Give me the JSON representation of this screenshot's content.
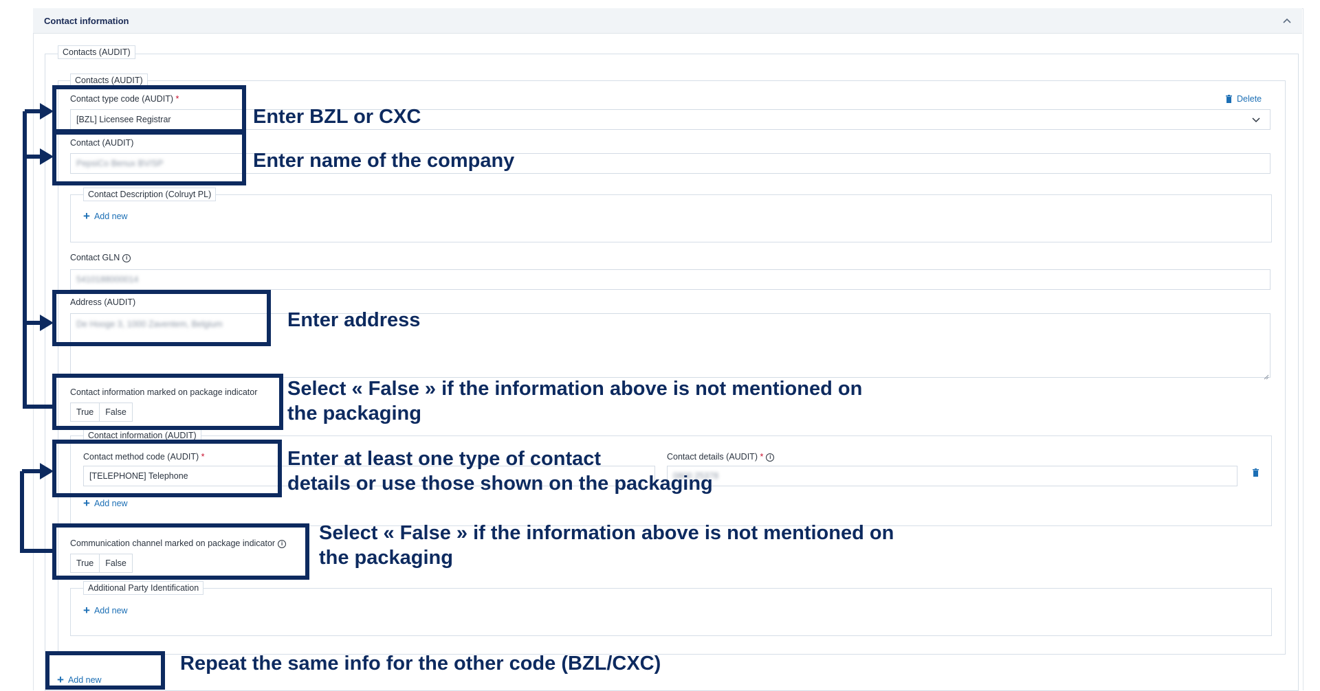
{
  "section": {
    "title": "Contact information"
  },
  "contacts_outer": {
    "legend": "Contacts (AUDIT)"
  },
  "contacts_inner": {
    "legend": "Contacts (AUDIT)",
    "delete_label": "Delete",
    "contact_type": {
      "label": "Contact type code (AUDIT)",
      "required_mark": "*",
      "value": "[BZL] Licensee Registrar"
    },
    "contact": {
      "label": "Contact (AUDIT)",
      "value": "PepsiCo Benux BV/SP"
    },
    "description": {
      "legend": "Contact Description (Colruyt PL)",
      "add_new": "Add new"
    },
    "gln": {
      "label": "Contact GLN",
      "value": "5410188000014"
    },
    "address": {
      "label": "Address (AUDIT)",
      "value": "De Hooge 3, 1000 Zaventem, Belgium"
    },
    "package_indicator": {
      "label": "Contact information marked on package indicator",
      "true_label": "True",
      "false_label": "False"
    },
    "contact_info": {
      "legend": "Contact information (AUDIT)",
      "method": {
        "label": "Contact method code (AUDIT)",
        "required_mark": "*",
        "value": "[TELEPHONE] Telephone"
      },
      "details": {
        "label": "Contact details (AUDIT)",
        "required_mark": "*",
        "value": "0800 25378"
      },
      "add_new": "Add new"
    },
    "channel_indicator": {
      "label": "Communication channel marked on package indicator",
      "true_label": "True",
      "false_label": "False"
    },
    "additional_party": {
      "legend": "Additional Party Identification",
      "add_new": "Add new"
    }
  },
  "bottom_add_new": "Add new",
  "annotations": {
    "a1": "Enter BZL or CXC",
    "a2": "Enter name of the company",
    "a3": "Enter address",
    "a4_line1": "Select « False » if  the information above is not mentioned on",
    "a4_line2": "the packaging",
    "a5_line1": "Enter at least one type of contact",
    "a5_line2": "details or use those shown on the packaging",
    "a6_line1": "Select « False » if the information above is not mentioned on",
    "a6_line2": "the packaging",
    "a7": "Repeat the same info for the other code (BZL/CXC)"
  },
  "colors": {
    "annotation": "#0d2a5f",
    "link": "#1c6fb5",
    "required": "#c8102e"
  }
}
